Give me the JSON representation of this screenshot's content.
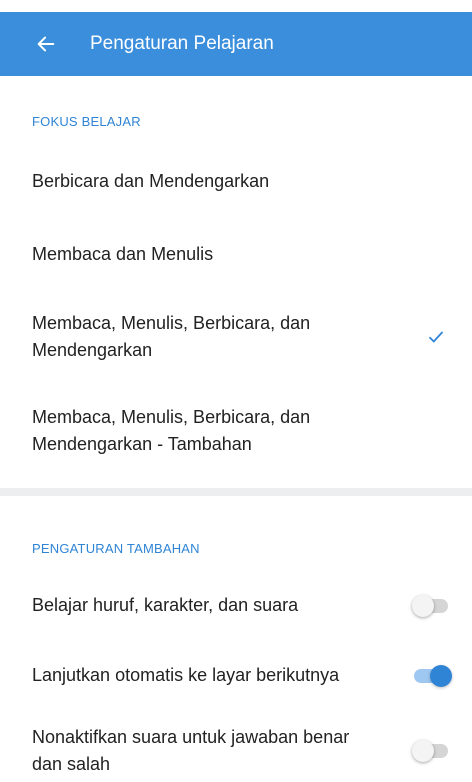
{
  "appbar": {
    "title": "Pengaturan Pelajaran",
    "back_icon": "arrow-left-icon"
  },
  "focus": {
    "header": "FOKUS BELAJAR",
    "options": [
      {
        "label": "Berbicara dan Mendengarkan",
        "selected": false
      },
      {
        "label": "Membaca dan Menulis",
        "selected": false
      },
      {
        "label": "Membaca, Menulis, Berbicara, dan Mendengarkan",
        "selected": true
      },
      {
        "label": "Membaca, Menulis, Berbicara, dan Mendengarkan - Tambahan",
        "selected": false
      }
    ]
  },
  "extra": {
    "header": "PENGATURAN TAMBAHAN",
    "settings": [
      {
        "label": "Belajar huruf, karakter, dan suara",
        "on": false
      },
      {
        "label": "Lanjutkan otomatis ke layar berikutnya",
        "on": true
      },
      {
        "label": "Nonaktifkan suara untuk jawaban benar dan salah",
        "on": false
      }
    ]
  },
  "colors": {
    "appbar": "#3a8edb",
    "accent": "#2f84d6"
  }
}
